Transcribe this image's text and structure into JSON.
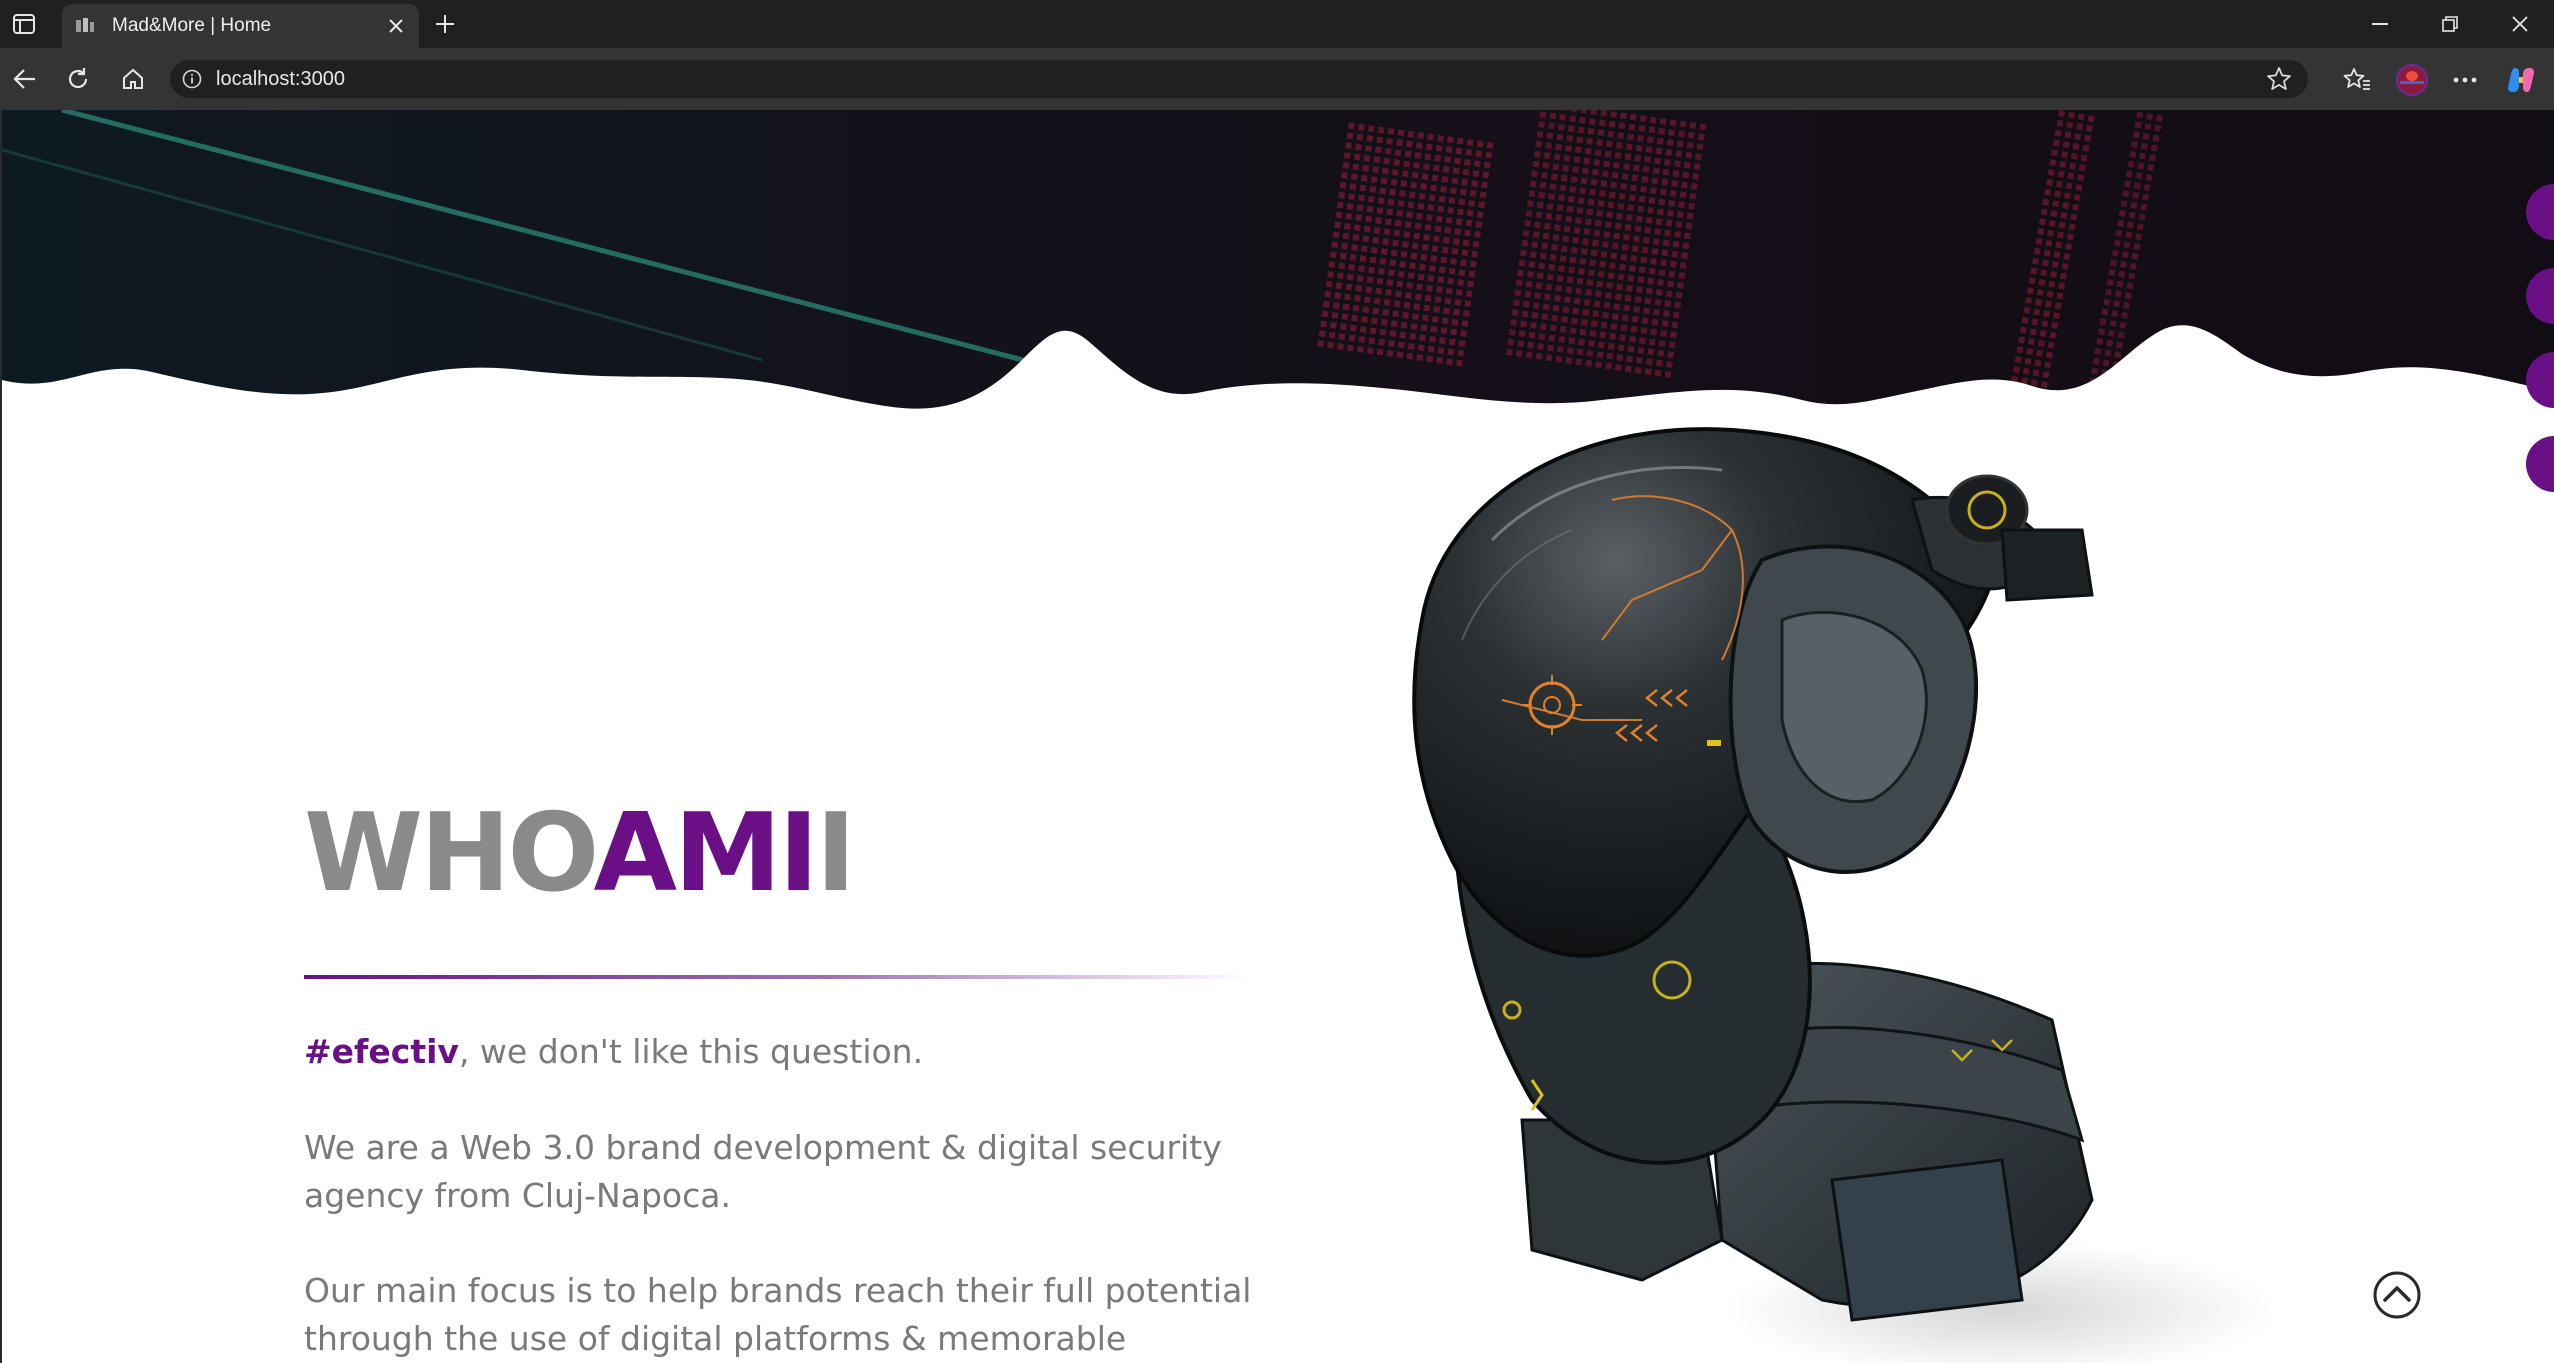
{
  "browser": {
    "tab_title": "Mad&More | Home",
    "url": "localhost:3000",
    "icons": [
      "tab-actions-icon",
      "favicon-icon",
      "close-icon",
      "plus-icon",
      "minimize-icon",
      "restore-icon",
      "close-window-icon",
      "back-icon",
      "reload-icon",
      "home-icon",
      "info-icon",
      "star-icon",
      "favorites-icon",
      "profile-avatar",
      "more-icon",
      "copilot-icon"
    ]
  },
  "page": {
    "headline_part1": "WHO",
    "headline_part2": "AMI",
    "headline_part3": "I",
    "hashtag": "#efectiv",
    "intro_rest": ", we don't like this question.",
    "paragraph1": "We are a Web 3.0 brand development & digital security agency from Cluj-Napoca.",
    "paragraph2": "Our main focus is to help brands reach their full potential through the use of digital platforms & memorable",
    "accent_color": "#6a0f86",
    "text_color": "#7a7a7a"
  }
}
